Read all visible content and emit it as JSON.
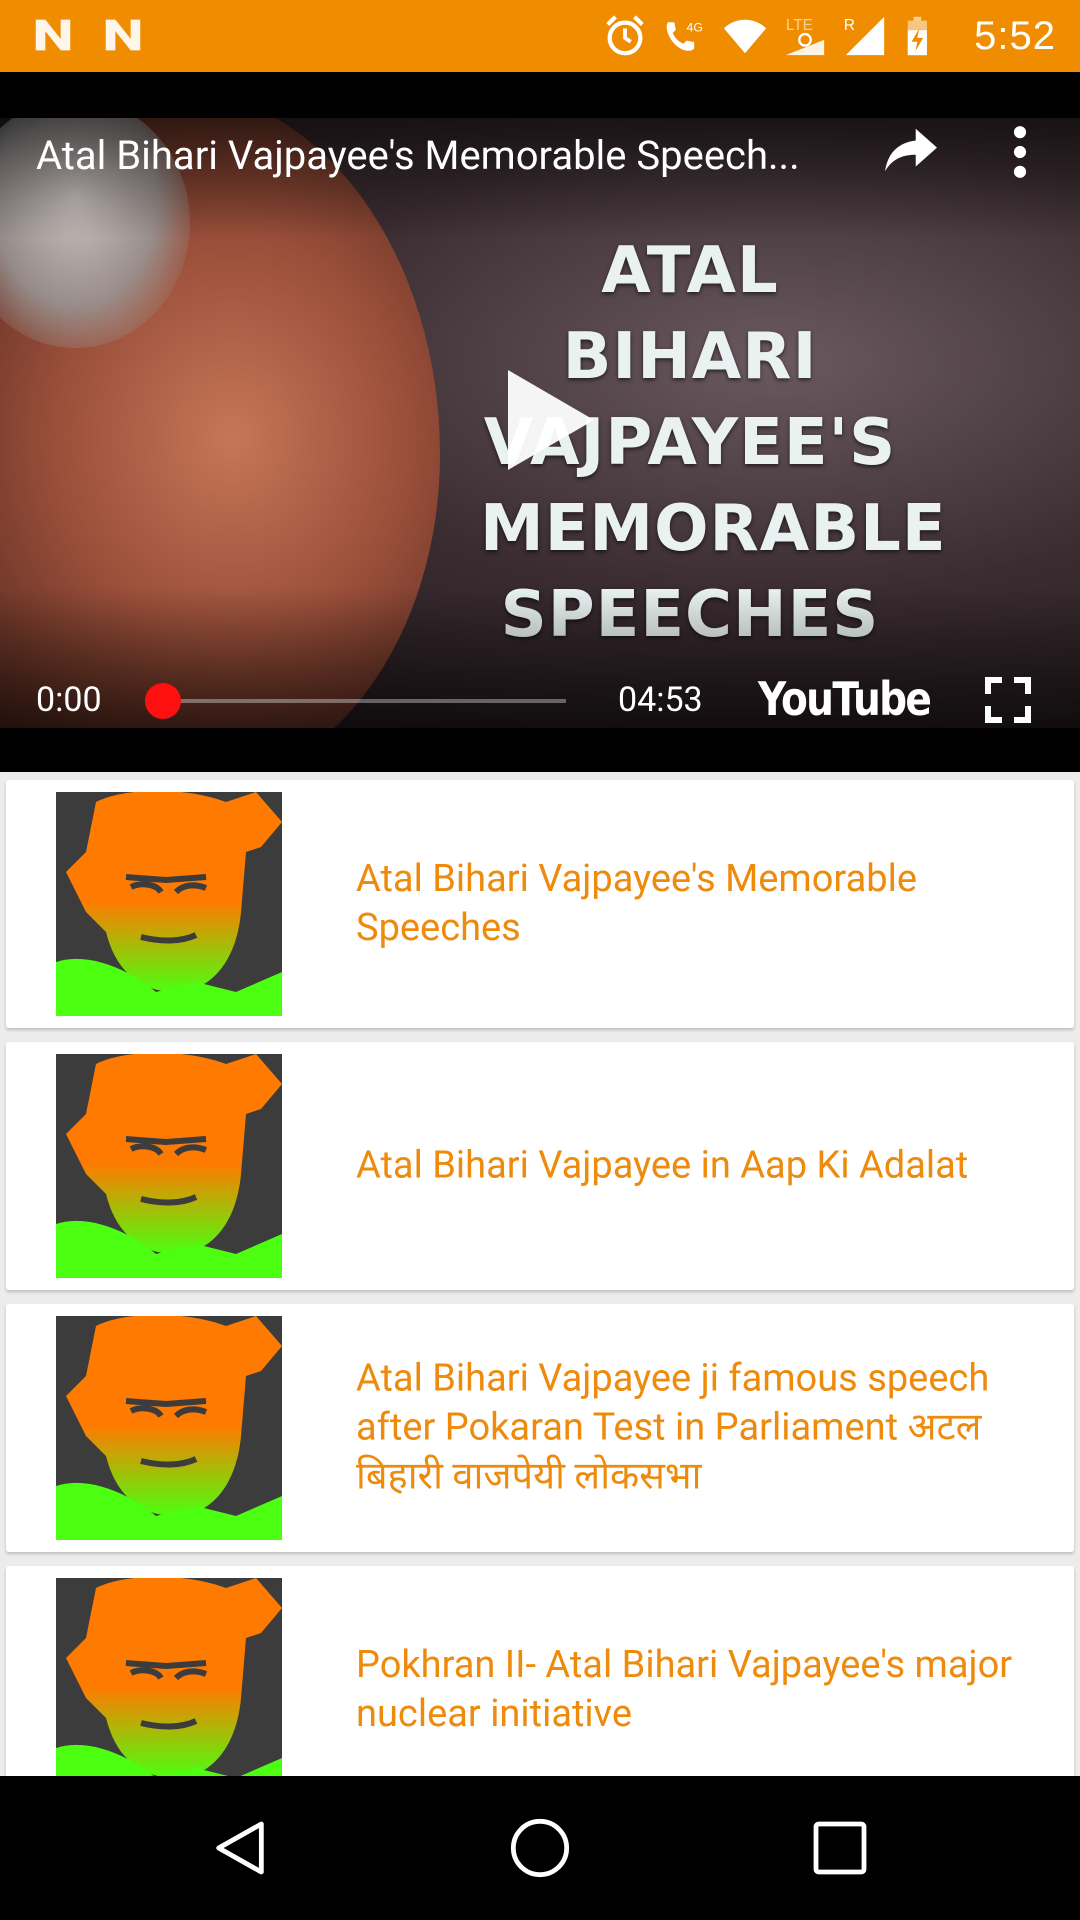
{
  "status_bar": {
    "time": "5:52",
    "network_label": "4G",
    "lte_label": "LTE",
    "roaming_label": "R",
    "background": "#f08c00"
  },
  "player": {
    "title": "Atal Bihari Vajpayee's Memorable Speech...",
    "thumbnail_text_lines": [
      "ATAL BIHARI",
      "VAJPAYEE'S",
      "MEMORABLE",
      "SPEECHES"
    ],
    "current_time": "0:00",
    "duration": "04:53",
    "brand": "YouTube",
    "progress": 0.0
  },
  "videos": [
    {
      "title": "Atal Bihari Vajpayee's Memorable Speeches"
    },
    {
      "title": "Atal Bihari Vajpayee in Aap Ki Adalat"
    },
    {
      "title": "Atal Bihari Vajpayee ji famous speech after Pokaran Test in Parliament अटल बिहारी वाजपेयी लोकसभा"
    },
    {
      "title": "Pokhran II- Atal Bihari Vajpayee's major nuclear initiative"
    }
  ],
  "colors": {
    "accent": "#ee8a0c",
    "seek": "#ff1010",
    "card_bg": "#ffffff",
    "list_bg": "#ececec"
  },
  "nav_bar": {
    "icons": [
      "back-icon",
      "home-icon",
      "recents-icon"
    ]
  }
}
